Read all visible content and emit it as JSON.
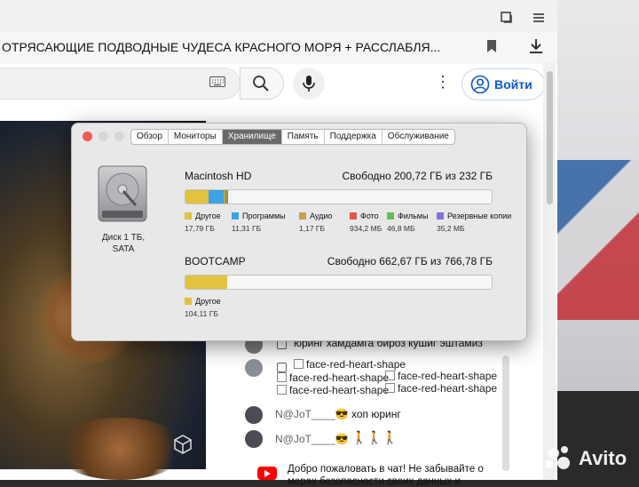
{
  "browser": {
    "tab_title": "ОТРЯСАЮЩИЕ ПОДВОДНЫЕ ЧУДЕСА КРАСНОГО МОРЯ + РАССЛАБЛЯ...",
    "signin_label": "Войти"
  },
  "about_mac": {
    "tabs": [
      {
        "label": "Обзор",
        "active": false
      },
      {
        "label": "Мониторы",
        "active": false
      },
      {
        "label": "Хранилище",
        "active": true
      },
      {
        "label": "Память",
        "active": false
      },
      {
        "label": "Поддержка",
        "active": false
      },
      {
        "label": "Обслуживание",
        "active": false
      }
    ],
    "disk": {
      "label_line1": "Диск 1 ТБ,",
      "label_line2": "SATA"
    },
    "volumes": [
      {
        "name": "Macintosh HD",
        "free_text": "Свободно 200,72 ГБ из 232 ГБ",
        "total_gb": 232,
        "categories": [
          {
            "label": "Другое",
            "size": "17,79 ГБ",
            "value_gb": 17.79,
            "color": "#e2c23f"
          },
          {
            "label": "Программы",
            "size": "11,31 ГБ",
            "value_gb": 11.31,
            "color": "#3aa3e3"
          },
          {
            "label": "Аудио",
            "size": "1,17 ГБ",
            "value_gb": 1.17,
            "color": "#caa04a"
          },
          {
            "label": "Фото",
            "size": "934,2 МБ",
            "value_gb": 0.934,
            "color": "#e0564f"
          },
          {
            "label": "Фильмы",
            "size": "46,8 МБ",
            "value_gb": 0.047,
            "color": "#5ac05a"
          },
          {
            "label": "Резервные копии",
            "size": "35,2 МБ",
            "value_gb": 0.035,
            "color": "#8a6de0"
          }
        ]
      },
      {
        "name": "BOOTCAMP",
        "free_text": "Свободно 662,67 ГБ из 766,78 ГБ",
        "total_gb": 766.78,
        "categories": [
          {
            "label": "Другое",
            "size": "104,11 ГБ",
            "value_gb": 104.11,
            "color": "#e2c23f"
          }
        ]
      }
    ]
  },
  "chat": {
    "messages": [
      {
        "text": "юринг хамдамга бироз кушиг эштамиз"
      },
      {
        "text": "face-red-heart-shape"
      },
      {
        "text": "face-red-heart-shape"
      },
      {
        "text": "face-red-heart-shape"
      },
      {
        "text": "face-red-heart-shape"
      },
      {
        "text": "face-red-heart-shape"
      },
      {
        "author": "N@JoT____😎",
        "text": "хоп юринг"
      },
      {
        "author": "N@JoT____😎",
        "text": "🚶🚶🚶"
      }
    ],
    "welcome_line1": "Добро пожаловать в чат! Не забывайте о",
    "welcome_line2": "мерах безопасности своих данных и"
  },
  "watermark": {
    "brand": "Avito"
  }
}
